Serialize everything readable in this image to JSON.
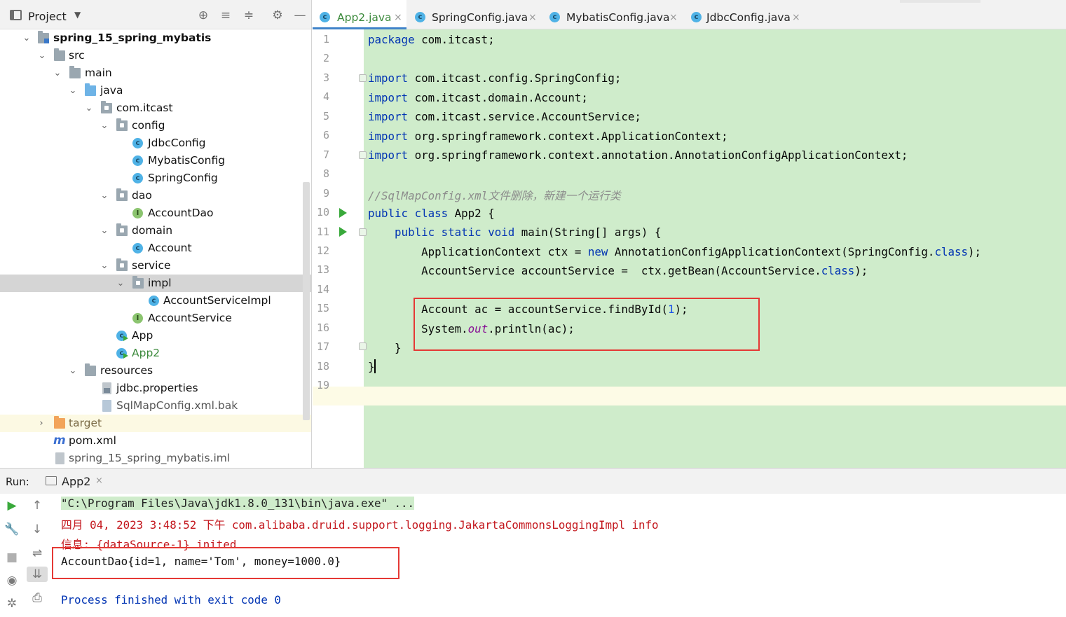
{
  "project_panel": {
    "title": "Project",
    "dropdown_icon": "chevron-down-icon",
    "tree": [
      {
        "label": "spring_15_spring_mybatis",
        "icon": "module-folder",
        "expanded": true
      },
      {
        "label": "src",
        "icon": "folder",
        "expanded": true
      },
      {
        "label": "main",
        "icon": "folder",
        "expanded": true
      },
      {
        "label": "java",
        "icon": "source-folder",
        "expanded": true
      },
      {
        "label": "com.itcast",
        "icon": "package",
        "expanded": true
      },
      {
        "label": "config",
        "icon": "package",
        "expanded": true
      },
      {
        "label": "JdbcConfig",
        "icon": "class"
      },
      {
        "label": "MybatisConfig",
        "icon": "class"
      },
      {
        "label": "SpringConfig",
        "icon": "class"
      },
      {
        "label": "dao",
        "icon": "package",
        "expanded": true
      },
      {
        "label": "AccountDao",
        "icon": "interface"
      },
      {
        "label": "domain",
        "icon": "package",
        "expanded": true
      },
      {
        "label": "Account",
        "icon": "class"
      },
      {
        "label": "service",
        "icon": "package",
        "expanded": true
      },
      {
        "label": "impl",
        "icon": "package",
        "expanded": true,
        "selected": true
      },
      {
        "label": "AccountServiceImpl",
        "icon": "class"
      },
      {
        "label": "AccountService",
        "icon": "interface"
      },
      {
        "label": "App",
        "icon": "runnable-class"
      },
      {
        "label": "App2",
        "icon": "runnable-class"
      },
      {
        "label": "resources",
        "icon": "resources-folder",
        "expanded": true
      },
      {
        "label": "jdbc.properties",
        "icon": "properties-file"
      },
      {
        "label": "SqlMapConfig.xml.bak",
        "icon": "bak-file"
      },
      {
        "label": "target",
        "icon": "excluded-folder",
        "expanded": false
      },
      {
        "label": "pom.xml",
        "icon": "maven-file"
      },
      {
        "label": "spring_15_spring_mybatis.iml",
        "icon": "iml-file"
      }
    ]
  },
  "editor": {
    "tabs": [
      {
        "label": "App2.java",
        "active": true
      },
      {
        "label": "SpringConfig.java",
        "active": false
      },
      {
        "label": "MybatisConfig.java",
        "active": false
      },
      {
        "label": "JdbcConfig.java",
        "active": false
      }
    ],
    "line_numbers": [
      "1",
      "2",
      "3",
      "4",
      "5",
      "6",
      "7",
      "8",
      "9",
      "10",
      "11",
      "12",
      "13",
      "14",
      "15",
      "16",
      "17",
      "18",
      "19"
    ],
    "code": {
      "l1_kw": "package",
      "l1_rest": " com.itcast;",
      "import_kw": "import",
      "l3": " com.itcast.config.SpringConfig;",
      "l4": " com.itcast.domain.Account;",
      "l5": " com.itcast.service.AccountService;",
      "l6": " org.springframework.context.ApplicationContext;",
      "l7": " org.springframework.context.annotation.AnnotationConfigApplicationContext;",
      "l9": "//SqlMapConfig.xml文件删除，新建一个运行类",
      "l10_kw": "public class",
      "l10_rest": " App2 {",
      "l11_kw": "    public static void",
      "l11_rest": " main(String[] args) {",
      "l12_a": "        ApplicationContext ctx = ",
      "l12_new": "new",
      "l12_b": " AnnotationConfigApplicationContext(SpringConfig.",
      "l12_cls": "class",
      "l12_c": ");",
      "l13_a": "        AccountService accountService =  ctx.getBean(AccountService.",
      "l13_cls": "class",
      "l13_c": ");",
      "l15_a": "        Account ac = accountService.findById(",
      "l15_num": "1",
      "l15_c": ");",
      "l16_a": "        System.",
      "l16_out": "out",
      "l16_c": ".println(ac);",
      "l17": "    }",
      "l18": "}"
    }
  },
  "run_panel": {
    "label": "Run:",
    "tab_name": "App2",
    "console_lines": [
      "\"C:\\Program Files\\Java\\jdk1.8.0_131\\bin\\java.exe\" ...",
      "四月 04, 2023 3:48:52 下午 com.alibaba.druid.support.logging.JakartaCommonsLoggingImpl info",
      "信息: {dataSource-1} inited",
      "AccountDao{id=1, name='Tom', money=1000.0}",
      "Process finished with exit code 0"
    ]
  },
  "colors": {
    "code_background": "#cfeccb",
    "keyword": "#0033b3",
    "highlight_box": "#e53935",
    "log_red": "#c3161c"
  }
}
